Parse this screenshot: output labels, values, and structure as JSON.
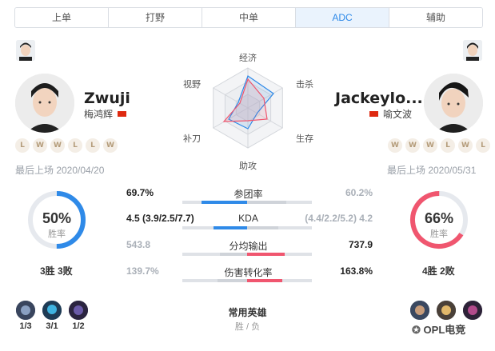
{
  "tabs": [
    {
      "label": "上单",
      "active": false
    },
    {
      "label": "打野",
      "active": false
    },
    {
      "label": "中单",
      "active": false
    },
    {
      "label": "ADC",
      "active": true
    },
    {
      "label": "辅助",
      "active": false
    }
  ],
  "colors": {
    "left": "#2f8ae8",
    "right": "#f0566f",
    "active_tab_bg": "#eaf3fd"
  },
  "left_player": {
    "name": "Zwuji",
    "real_name": "梅鸿辉",
    "form": [
      "L",
      "W",
      "W",
      "L",
      "L",
      "W"
    ],
    "last_played": "最后上场 2020/04/20",
    "win_rate": "50%",
    "win_rate_value": 0.5,
    "win_label": "胜率",
    "record": "3胜 3败",
    "champions": [
      {
        "icon": "champion-1-icon",
        "score": "1/3"
      },
      {
        "icon": "champion-2-icon",
        "score": "3/1"
      },
      {
        "icon": "champion-3-icon",
        "score": "1/2"
      }
    ]
  },
  "right_player": {
    "name": "Jackeylo...",
    "real_name": "喻文波",
    "form": [
      "W",
      "W",
      "W",
      "L",
      "W",
      "L"
    ],
    "last_played": "最后上场 2020/05/31",
    "win_rate": "66%",
    "win_rate_value": 0.66,
    "win_label": "胜率",
    "record": "4胜 2败",
    "champions": [
      {
        "icon": "champion-4-icon",
        "score": ""
      },
      {
        "icon": "champion-5-icon",
        "score": ""
      },
      {
        "icon": "champion-6-icon",
        "score": ""
      }
    ]
  },
  "radar_labels": [
    "经济",
    "击杀",
    "生存",
    "助攻",
    "补刀",
    "视野"
  ],
  "stats": [
    {
      "label": "参团率",
      "left": "69.7%",
      "right": "60.2%",
      "left_frac": 0.7,
      "right_frac": 0.6,
      "leader": "left"
    },
    {
      "label": "KDA",
      "left": "4.5 (3.9/2.5/7.7)",
      "right": "(4.4/2.2/5.2) 4.2",
      "left_frac": 0.52,
      "right_frac": 0.48,
      "leader": "left"
    },
    {
      "label": "分均输出",
      "left": "543.8",
      "right": "737.9",
      "left_frac": 0.42,
      "right_frac": 0.58,
      "leader": "right"
    },
    {
      "label": "伤害转化率",
      "left": "139.7%",
      "right": "163.8%",
      "left_frac": 0.46,
      "right_frac": 0.54,
      "leader": "right"
    }
  ],
  "common_heroes": {
    "title": "常用英雄",
    "subtitle": "胜 / 负"
  },
  "watermark": "OPL电竞"
}
